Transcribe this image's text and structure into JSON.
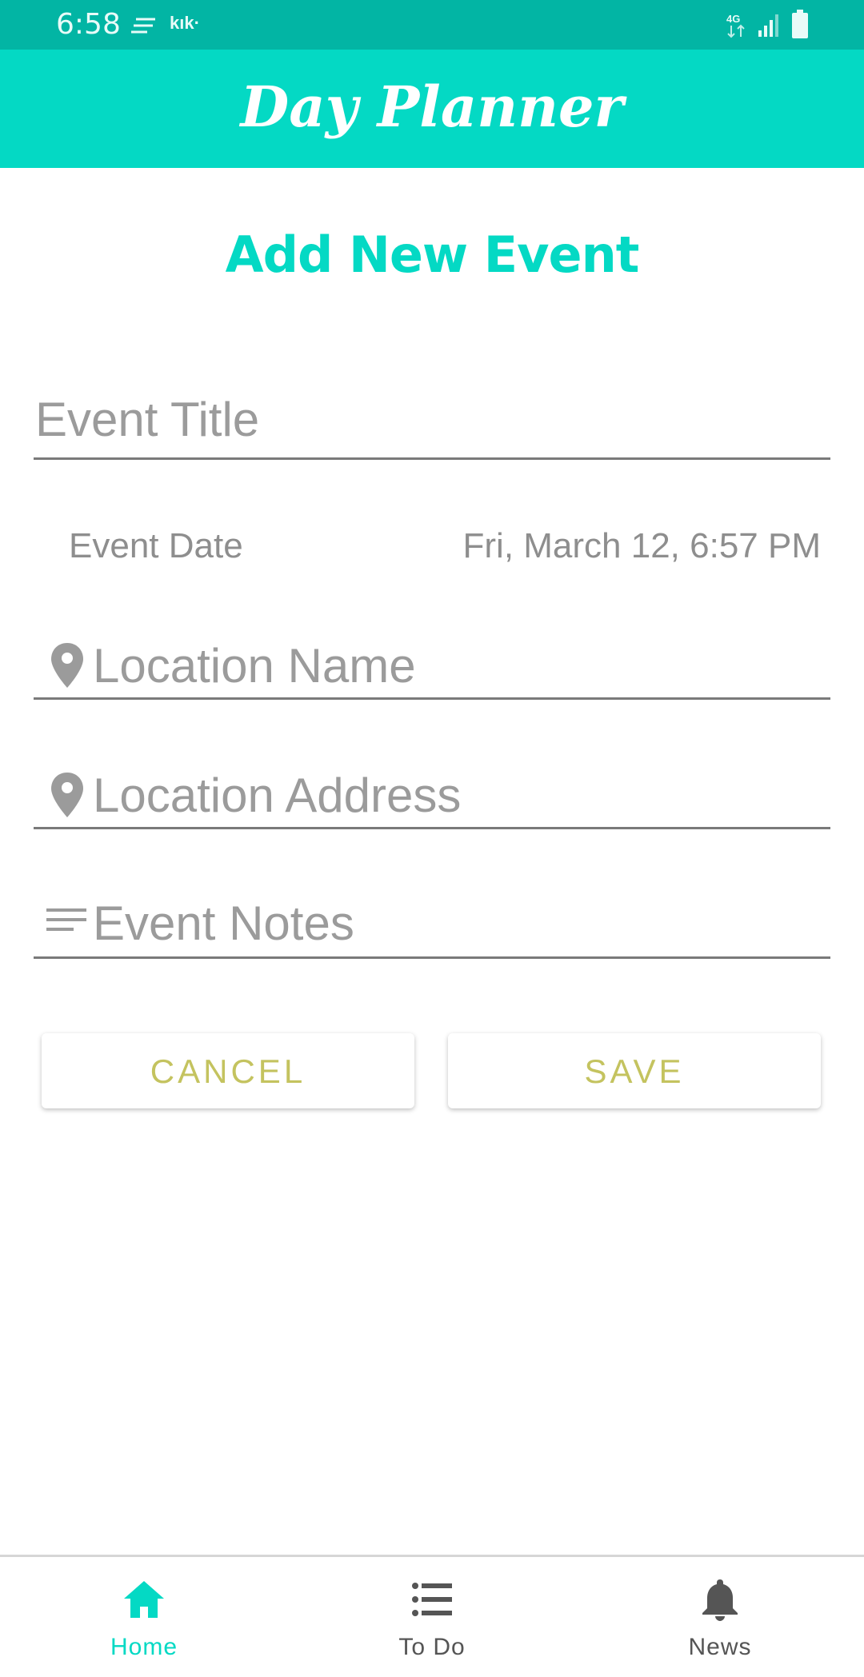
{
  "status_bar": {
    "time": "6:58",
    "notification_app": "kık·",
    "icons": [
      "notification-lines-icon",
      "mobile-data-icon",
      "signal-icon",
      "battery-icon"
    ]
  },
  "app_bar": {
    "title": "Day Planner"
  },
  "form": {
    "heading": "Add New Event",
    "title_placeholder": "Event Title",
    "date_label": "Event Date",
    "date_value": "Fri, March 12, 6:57 PM",
    "location_name_placeholder": "Location Name",
    "location_address_placeholder": "Location Address",
    "notes_placeholder": "Event Notes"
  },
  "buttons": {
    "cancel": "CANCEL",
    "save": "SAVE"
  },
  "bottom_nav": {
    "items": [
      {
        "label": "Home",
        "icon": "home-icon",
        "active": true
      },
      {
        "label": "To Do",
        "icon": "list-icon",
        "active": false
      },
      {
        "label": "News",
        "icon": "bell-icon",
        "active": false
      }
    ]
  },
  "colors": {
    "status_bar": "#02b5a4",
    "accent": "#04d9c4",
    "button_text": "#c4c35f",
    "placeholder": "#9b9b9b"
  }
}
